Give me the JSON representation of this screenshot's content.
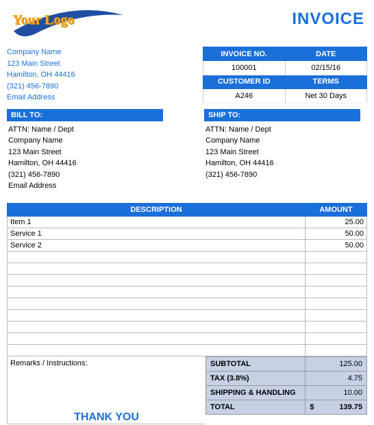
{
  "logo": {
    "text": "Your Logo"
  },
  "title": "INVOICE",
  "company": {
    "name": "Company Name",
    "street": "123 Main Street",
    "city_state_zip": "Hamilton, OH  44416",
    "phone": "(321) 456-7890",
    "email": "Email Address"
  },
  "meta": {
    "invoice_no_label": "INVOICE NO.",
    "invoice_no": "100001",
    "date_label": "DATE",
    "date": "02/15/16",
    "customer_id_label": "CUSTOMER ID",
    "customer_id": "A246",
    "terms_label": "TERMS",
    "terms": "Net 30 Days"
  },
  "bill_to": {
    "header": "BILL TO:",
    "attn": "ATTN: Name / Dept",
    "company": "Company Name",
    "street": "123 Main Street",
    "city_state_zip": "Hamilton, OH  44416",
    "phone": "(321) 456-7890",
    "email": "Email Address"
  },
  "ship_to": {
    "header": "SHIP TO:",
    "attn": "ATTN: Name / Dept",
    "company": "Company Name",
    "street": "123 Main Street",
    "city_state_zip": "Hamilton, OH  44416",
    "phone": "(321) 456-7890"
  },
  "columns": {
    "description": "DESCRIPTION",
    "amount": "AMOUNT"
  },
  "items": [
    {
      "desc": "Item 1",
      "amount": "25.00"
    },
    {
      "desc": "Service 1",
      "amount": "50.00"
    },
    {
      "desc": "Service 2",
      "amount": "50.00"
    },
    {
      "desc": "",
      "amount": ""
    },
    {
      "desc": "",
      "amount": ""
    },
    {
      "desc": "",
      "amount": ""
    },
    {
      "desc": "",
      "amount": ""
    },
    {
      "desc": "",
      "amount": ""
    },
    {
      "desc": "",
      "amount": ""
    },
    {
      "desc": "",
      "amount": ""
    },
    {
      "desc": "",
      "amount": ""
    },
    {
      "desc": "",
      "amount": ""
    }
  ],
  "remarks_label": "Remarks / Instructions:",
  "thanks": "THANK YOU",
  "totals": {
    "subtotal_label": "SUBTOTAL",
    "subtotal": "125.00",
    "tax_label": "TAX (3.8%)",
    "tax": "4.75",
    "shipping_label": "SHIPPING & HANDLING",
    "shipping": "10.00",
    "total_label": "TOTAL",
    "currency": "$",
    "total": "139.75"
  }
}
